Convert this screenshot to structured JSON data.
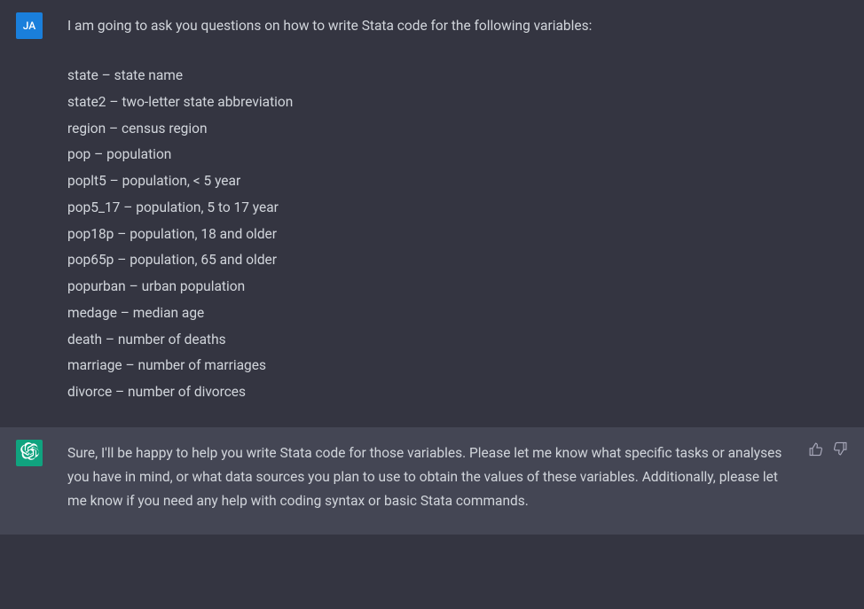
{
  "user": {
    "avatar_initials": "JA",
    "intro": "I am going to ask you questions on how to write Stata code for the following variables:",
    "variables": [
      "state – state name",
      "state2 – two-letter state abbreviation",
      "region –  census region",
      "pop – population",
      "poplt5 – population, < 5 year",
      "pop5_17 – population, 5 to 17 year",
      "pop18p – population, 18 and older",
      "pop65p – population, 65 and older",
      "popurban – urban population",
      "medage – median age",
      "death – number of deaths",
      "marriage – number of marriages",
      "divorce – number of divorces"
    ]
  },
  "assistant": {
    "response": "Sure, I'll be happy to help you write Stata code for those variables. Please let me know what specific tasks or analyses you have in mind, or what data sources you plan to use to obtain the values of these variables. Additionally, please let me know if you need any help with coding syntax or basic Stata commands."
  }
}
